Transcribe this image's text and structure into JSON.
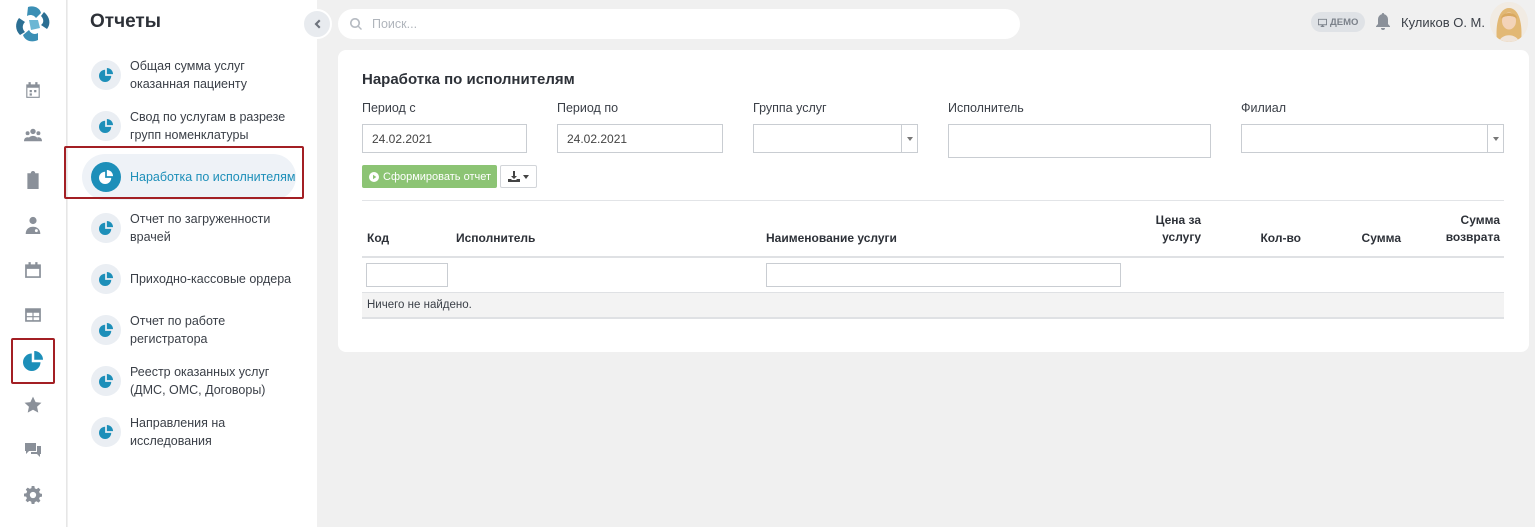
{
  "sidebar": {
    "title": "Отчеты",
    "items": [
      {
        "label": "Общая сумма услуг оказанная пациенту"
      },
      {
        "label": "Свод по услугам в разрезе групп номенклатуры"
      },
      {
        "label": "Наработка по исполнителям"
      },
      {
        "label": "Отчет по загруженности врачей"
      },
      {
        "label": "Приходно-кассовые ордера"
      },
      {
        "label": "Отчет по работе регистратора"
      },
      {
        "label": "Реестр оказанных услуг (ДМС, ОМС, Договоры)"
      },
      {
        "label": "Направления на исследования"
      }
    ],
    "active_index": 2
  },
  "rail": {
    "icons": [
      "calendar-icon",
      "users-icon",
      "clipboard-icon",
      "doctor-icon",
      "schedule-icon",
      "table-icon",
      "pie-chart-icon",
      "star-icon",
      "chat-icon",
      "gear-icon"
    ],
    "active": "pie-chart-icon"
  },
  "header": {
    "search_placeholder": "Поиск...",
    "demo_badge": "ДЕМО",
    "user_name": "Куликов О. М."
  },
  "report": {
    "title": "Наработка по исполнителям",
    "filters": {
      "period_from_label": "Период с",
      "period_from_value": "24.02.2021",
      "period_to_label": "Период по",
      "period_to_value": "24.02.2021",
      "service_group_label": "Группа услуг",
      "service_group_value": "",
      "executor_label": "Исполнитель",
      "executor_value": "",
      "branch_label": "Филиал",
      "branch_value": ""
    },
    "generate_button": "Сформировать отчет",
    "table": {
      "columns": [
        "Код",
        "Исполнитель",
        "Наименование услуги",
        "Цена за услугу",
        "Кол-во",
        "Сумма",
        "Сумма возврата"
      ],
      "empty_message": "Ничего не найдено."
    }
  },
  "colors": {
    "accent": "#1d8fb9",
    "highlight_frame": "#a31f24",
    "generate_button": "#8cc474"
  }
}
